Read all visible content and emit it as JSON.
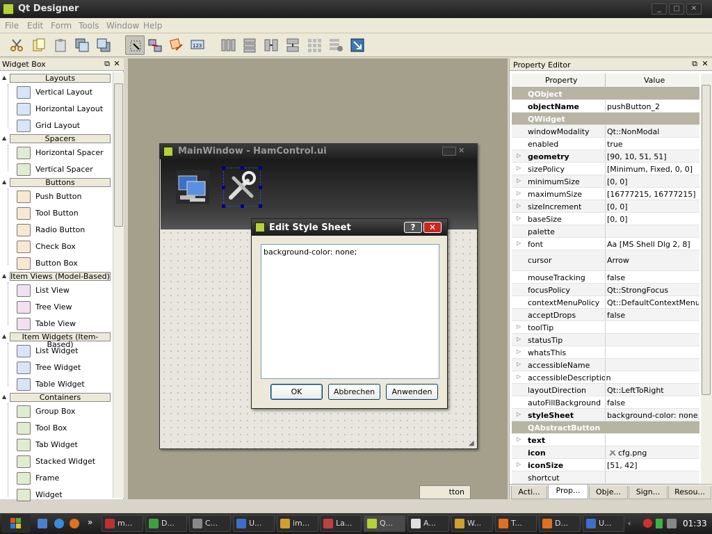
{
  "app": {
    "title": "Qt Designer"
  },
  "menu": [
    "File",
    "Edit",
    "Form",
    "Tools",
    "Window",
    "Help"
  ],
  "widget_box": {
    "title": "Widget Box",
    "categories": [
      {
        "name": "Layouts",
        "items": [
          "Vertical Layout",
          "Horizontal Layout",
          "Grid Layout"
        ]
      },
      {
        "name": "Spacers",
        "items": [
          "Horizontal Spacer",
          "Vertical Spacer"
        ]
      },
      {
        "name": "Buttons",
        "items": [
          "Push Button",
          "Tool Button",
          "Radio Button",
          "Check Box",
          "Button Box"
        ]
      },
      {
        "name": "Item Views (Model-Based)",
        "items": [
          "List View",
          "Tree View",
          "Table View"
        ]
      },
      {
        "name": "Item Widgets (Item-Based)",
        "items": [
          "List Widget",
          "Tree Widget",
          "Table Widget"
        ]
      },
      {
        "name": "Containers",
        "items": [
          "Group Box",
          "Tool Box",
          "Tab Widget",
          "Stacked Widget",
          "Frame",
          "Widget"
        ]
      }
    ]
  },
  "form_window": {
    "title": "MainWindow - HamControl.ui",
    "hidden_button_text": "tton"
  },
  "dialog": {
    "title": "Edit Style Sheet",
    "help": "?",
    "close": "✕",
    "text": "background-color: none;",
    "ok": "OK",
    "cancel": "Abbrechen",
    "apply": "Anwenden"
  },
  "property_editor": {
    "title": "Property Editor",
    "col_property": "Property",
    "col_value": "Value",
    "rows": [
      {
        "name": "QObject",
        "value": "",
        "section": true
      },
      {
        "name": "objectName",
        "value": "pushButton_2",
        "bold": true
      },
      {
        "name": "QWidget",
        "value": "",
        "section": true
      },
      {
        "name": "windowModality",
        "value": "Qt::NonModal"
      },
      {
        "name": "enabled",
        "value": "true"
      },
      {
        "name": "geometry",
        "value": "[90, 10, 51, 51]",
        "bold": true,
        "expand": true
      },
      {
        "name": "sizePolicy",
        "value": "[Minimum, Fixed, 0, 0]",
        "expand": true
      },
      {
        "name": "minimumSize",
        "value": "[0, 0]",
        "expand": true
      },
      {
        "name": "maximumSize",
        "value": "[16777215, 16777215]",
        "expand": true
      },
      {
        "name": "sizeIncrement",
        "value": "[0, 0]",
        "expand": true
      },
      {
        "name": "baseSize",
        "value": "[0, 0]",
        "expand": true
      },
      {
        "name": "palette",
        "value": ""
      },
      {
        "name": "font",
        "value": "Aa   [MS Shell Dlg 2, 8]",
        "expand": true
      },
      {
        "name": "cursor",
        "value": "     Arrow",
        "tall": true
      },
      {
        "name": "mouseTracking",
        "value": "false"
      },
      {
        "name": "focusPolicy",
        "value": "Qt::StrongFocus"
      },
      {
        "name": "contextMenuPolicy",
        "value": "Qt::DefaultContextMenu"
      },
      {
        "name": "acceptDrops",
        "value": "false"
      },
      {
        "name": "toolTip",
        "value": "",
        "expand": true
      },
      {
        "name": "statusTip",
        "value": "",
        "expand": true
      },
      {
        "name": "whatsThis",
        "value": "",
        "expand": true
      },
      {
        "name": "accessibleName",
        "value": "",
        "expand": true
      },
      {
        "name": "accessibleDescription",
        "value": "",
        "expand": true
      },
      {
        "name": "layoutDirection",
        "value": "Qt::LeftToRight"
      },
      {
        "name": "autoFillBackground",
        "value": "false"
      },
      {
        "name": "styleSheet",
        "value": "background-color: none;",
        "bold": true,
        "expand": true
      },
      {
        "name": "QAbstractButton",
        "value": "",
        "section": true
      },
      {
        "name": "text",
        "value": "",
        "bold": true,
        "expand": true
      },
      {
        "name": "icon",
        "value": "cfg.png",
        "bold": true,
        "icon": true
      },
      {
        "name": "iconSize",
        "value": "[51, 42]",
        "bold": true,
        "expand": true
      },
      {
        "name": "shortcut",
        "value": ""
      }
    ],
    "tabs": [
      "Acti...",
      "Prop...",
      "Obje...",
      "Sign...",
      "Resou..."
    ]
  },
  "taskbar": {
    "items": [
      "m...",
      "D...",
      "C...",
      "U...",
      "im...",
      "La...",
      "Q...",
      "A...",
      "W...",
      "T...",
      "D...",
      "U..."
    ],
    "clock": "01:33"
  }
}
